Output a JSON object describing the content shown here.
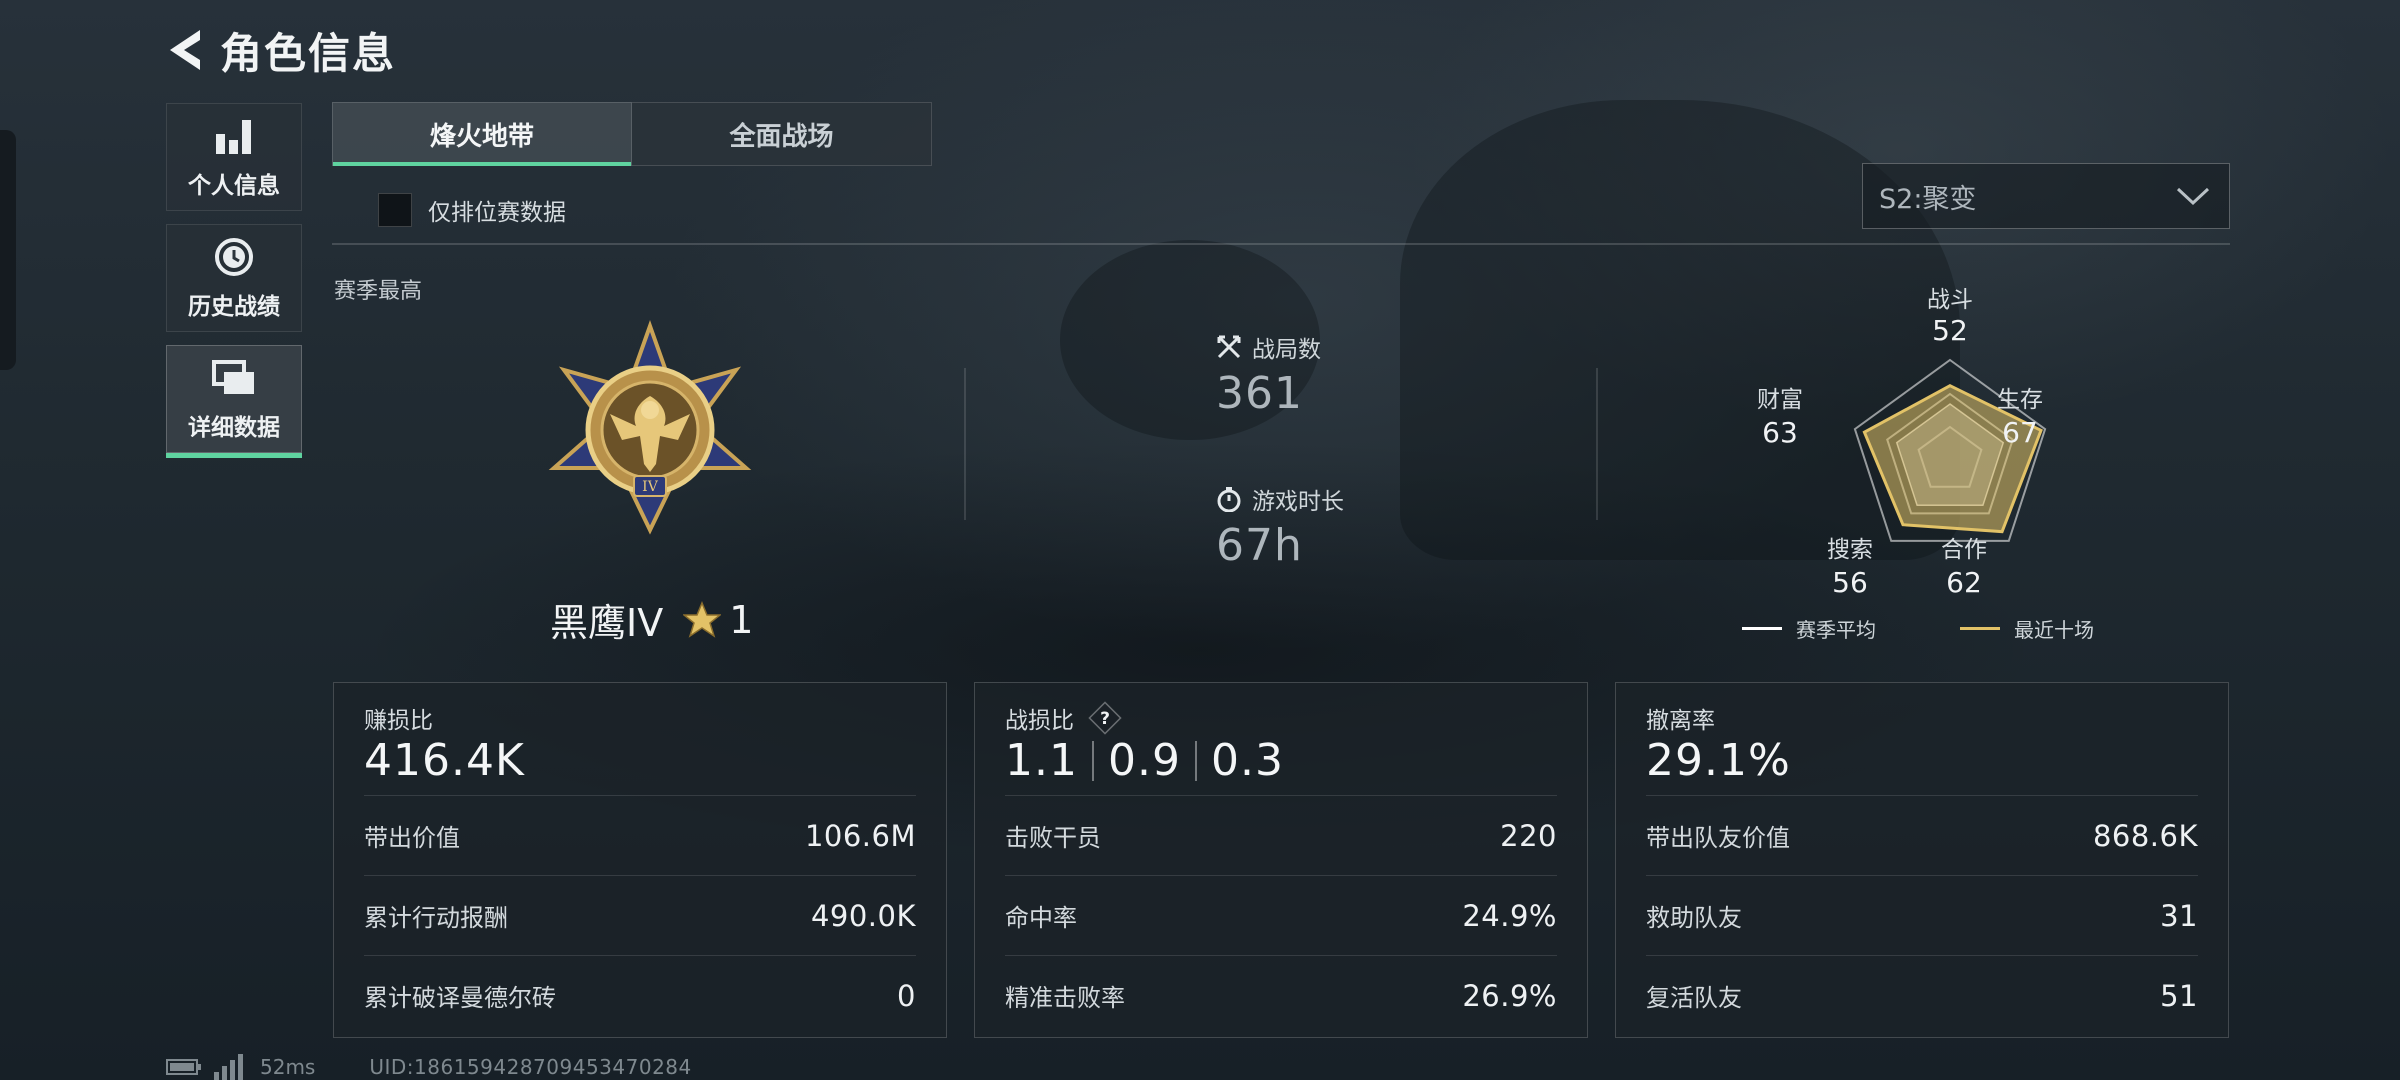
{
  "header": {
    "title": "角色信息"
  },
  "sidebar": {
    "items": [
      {
        "label": "个人信息",
        "icon": "bar-chart-icon",
        "active": false
      },
      {
        "label": "历史战绩",
        "icon": "history-clock-icon",
        "active": false
      },
      {
        "label": "详细数据",
        "icon": "cards-stack-icon",
        "active": true
      }
    ]
  },
  "tabs": [
    {
      "label": "烽火地带",
      "active": true
    },
    {
      "label": "全面战场",
      "active": false
    }
  ],
  "filter": {
    "ranked_only_label": "仅排位赛数据",
    "checked": false
  },
  "season_select": {
    "value": "S2:聚变"
  },
  "season_best": {
    "label": "赛季最高",
    "rank_name": "黑鹰IV",
    "stars": "1"
  },
  "stats": {
    "matches": {
      "label": "战局数",
      "value": "361",
      "icon": "crossed-swords-icon"
    },
    "playtime": {
      "label": "游戏时长",
      "value": "67h",
      "icon": "stopwatch-icon"
    }
  },
  "radar": {
    "axes": [
      {
        "label": "战斗",
        "value": "52"
      },
      {
        "label": "生存",
        "value": "67"
      },
      {
        "label": "合作",
        "value": "62"
      },
      {
        "label": "搜索",
        "value": "56"
      },
      {
        "label": "财富",
        "value": "63"
      }
    ],
    "legend": [
      {
        "label": "赛季平均",
        "color": "#ffffff"
      },
      {
        "label": "最近十场",
        "color": "#e2c267"
      }
    ]
  },
  "cards": {
    "profit": {
      "title": "赚损比",
      "big": "416.4K",
      "rows": [
        {
          "label": "带出价值",
          "value": "106.6M"
        },
        {
          "label": "累计行动报酬",
          "value": "490.0K"
        },
        {
          "label": "累计破译曼德尔砖",
          "value": "0"
        }
      ]
    },
    "kd": {
      "title": "战损比",
      "big": [
        "1.1",
        "0.9",
        "0.3"
      ],
      "rows": [
        {
          "label": "击败干员",
          "value": "220"
        },
        {
          "label": "命中率",
          "value": "24.9%"
        },
        {
          "label": "精准击败率",
          "value": "26.9%"
        }
      ]
    },
    "extract": {
      "title": "撤离率",
      "big": "29.1%",
      "rows": [
        {
          "label": "带出队友价值",
          "value": "868.6K"
        },
        {
          "label": "救助队友",
          "value": "31"
        },
        {
          "label": "复活队友",
          "value": "51"
        }
      ]
    }
  },
  "footer": {
    "ping": "52ms",
    "uid": "UID:1861594287094534702​84"
  },
  "colors": {
    "accent": "#5fd3a0",
    "gold": "#e2c267"
  }
}
